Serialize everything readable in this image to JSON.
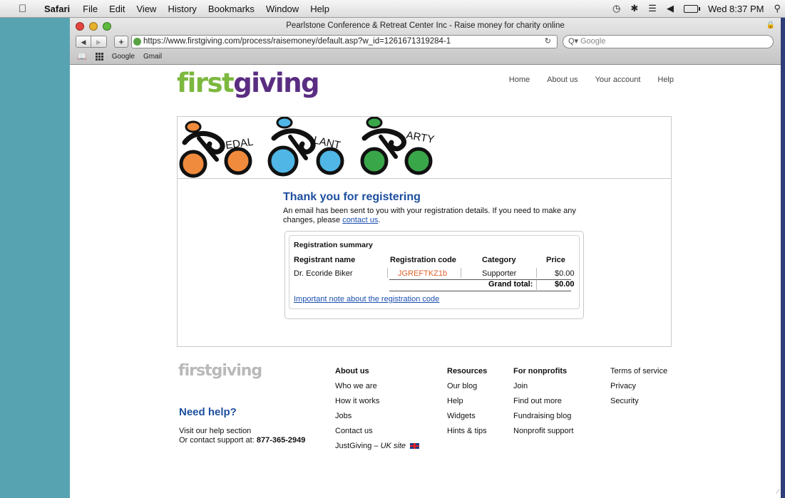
{
  "menubar": {
    "app": "Safari",
    "items": [
      "File",
      "Edit",
      "View",
      "History",
      "Bookmarks",
      "Window",
      "Help"
    ],
    "clock": "Wed 8:37 PM"
  },
  "browser": {
    "title": "Pearlstone Conference & Retreat Center Inc - Raise money for charity online",
    "url": "https://www.firstgiving.com/process/raisemoney/default.asp?w_id=1261671319284-1",
    "search_placeholder": "Google",
    "bookmarks": [
      "Google",
      "Gmail"
    ]
  },
  "site": {
    "logo_part1": "first",
    "logo_part2": "giving",
    "nav": [
      "Home",
      "About us",
      "Your account",
      "Help"
    ]
  },
  "banner": {
    "words": [
      "EDAL",
      "LANT",
      "ARTY"
    ],
    "colors": [
      "#f08a3c",
      "#4fb6e6",
      "#3aa64a"
    ]
  },
  "confirmation": {
    "heading": "Thank you for registering",
    "message": "An email has been sent to you with your registration details. If you need to make any changes, please",
    "link": "contact us",
    "period": "."
  },
  "summary": {
    "title": "Registration summary",
    "headers": {
      "name": "Registrant name",
      "code": "Registration code",
      "category": "Category",
      "price": "Price"
    },
    "row": {
      "name": "Dr. Ecoride Biker",
      "code": "JGREFTKZ1b",
      "category": "Supporter",
      "price": "$0.00"
    },
    "grand_total_label": "Grand total:",
    "grand_total": "$0.00",
    "note_link": "Important note about the registration code"
  },
  "footer": {
    "logo": "firstgiving",
    "need_help": "Need help?",
    "help_line1": "Visit our help section",
    "help_line2_prefix": "Or contact support at:",
    "phone": "877-365-2949",
    "about": {
      "heading": "About us",
      "items": [
        "Who we are",
        "How it works",
        "Jobs",
        "Contact us"
      ],
      "justgiving": "JustGiving",
      "justgiving_sep": " – ",
      "uk_site": "UK site"
    },
    "resources": {
      "heading": "Resources",
      "items": [
        "Our blog",
        "Help",
        "Widgets",
        "Hints & tips"
      ]
    },
    "nonprofits": {
      "heading": "For nonprofits",
      "items": [
        "Join",
        "Find out more",
        "Fundraising blog",
        "Nonprofit support"
      ]
    },
    "legal": [
      "Terms of service",
      "Privacy",
      "Security"
    ]
  }
}
